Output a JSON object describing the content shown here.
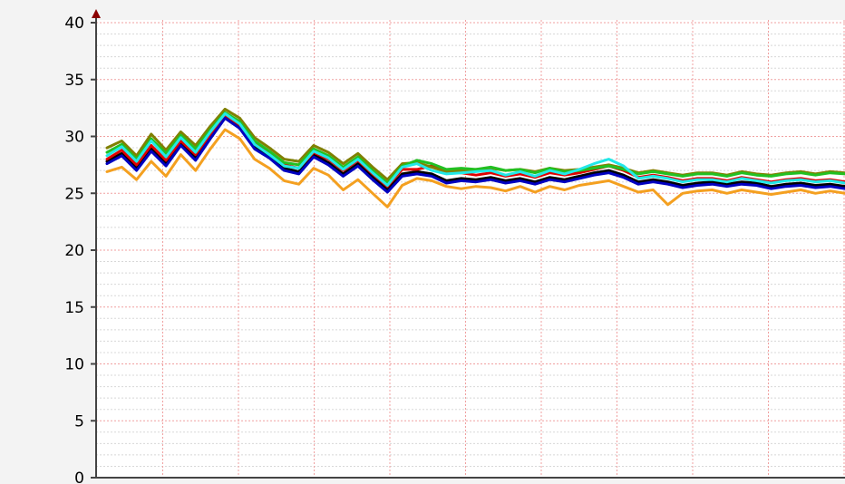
{
  "chart_data": {
    "type": "line",
    "title": "",
    "xlabel": "",
    "ylabel": "",
    "ylim": [
      0,
      40
    ],
    "yticks": [
      0,
      5,
      10,
      15,
      20,
      25,
      30,
      35,
      40
    ],
    "xlim": [
      0,
      100
    ],
    "grid": true,
    "x": [
      0,
      2,
      4,
      6,
      8,
      10,
      12,
      14,
      16,
      18,
      20,
      22,
      24,
      26,
      28,
      30,
      32,
      34,
      36,
      38,
      40,
      42,
      44,
      46,
      48,
      50,
      52,
      54,
      56,
      58,
      60,
      62,
      64,
      66,
      68,
      70,
      72,
      74,
      76,
      78,
      80,
      82,
      84,
      86,
      88,
      90,
      92,
      94,
      96,
      98,
      100
    ],
    "series": [
      {
        "color": "#000000",
        "values": [
          27.8,
          28.5,
          27.2,
          28.9,
          27.6,
          29.4,
          28.1,
          30.0,
          31.8,
          30.9,
          29.1,
          28.3,
          27.2,
          26.9,
          28.4,
          27.7,
          26.7,
          27.6,
          26.4,
          25.3,
          26.7,
          26.9,
          26.7,
          26.1,
          26.3,
          26.2,
          26.4,
          26.1,
          26.3,
          26.0,
          26.4,
          26.2,
          26.5,
          26.8,
          27.0,
          26.6,
          26.0,
          26.2,
          26.0,
          25.7,
          25.9,
          26.0,
          25.8,
          26.0,
          25.9,
          25.6,
          25.8,
          25.9,
          25.7,
          25.8,
          25.6
        ]
      },
      {
        "color": "#e00000",
        "values": [
          28.0,
          28.8,
          27.5,
          29.2,
          27.9,
          29.6,
          28.4,
          30.2,
          31.9,
          31.0,
          29.4,
          28.6,
          27.5,
          27.2,
          28.6,
          28.0,
          27.0,
          27.9,
          26.7,
          25.6,
          27.1,
          27.1,
          27.4,
          26.9,
          26.8,
          26.6,
          26.8,
          26.5,
          26.7,
          26.4,
          26.8,
          26.6,
          26.8,
          27.1,
          27.4,
          27.0,
          26.4,
          26.6,
          26.4,
          26.1,
          26.3,
          26.3,
          26.1,
          26.4,
          26.2,
          26.0,
          26.2,
          26.3,
          26.1,
          26.2,
          26.0
        ]
      },
      {
        "color": "#0000c0",
        "values": [
          27.6,
          28.3,
          27.0,
          28.7,
          27.4,
          29.2,
          27.9,
          29.8,
          31.6,
          30.7,
          28.9,
          28.1,
          27.0,
          26.7,
          28.2,
          27.5,
          26.5,
          27.4,
          26.2,
          25.1,
          26.5,
          26.7,
          26.5,
          25.9,
          26.1,
          26.0,
          26.2,
          25.9,
          26.1,
          25.8,
          26.2,
          26.0,
          26.3,
          26.6,
          26.8,
          26.4,
          25.8,
          26.0,
          25.8,
          25.5,
          25.7,
          25.8,
          25.6,
          25.8,
          25.7,
          25.4,
          25.6,
          25.7,
          25.5,
          25.6,
          25.4
        ]
      },
      {
        "color": "#808000",
        "values": [
          29.0,
          29.6,
          28.3,
          30.2,
          28.8,
          30.4,
          29.2,
          30.9,
          32.4,
          31.6,
          29.9,
          29.0,
          28.0,
          27.8,
          29.2,
          28.6,
          27.6,
          28.5,
          27.3,
          26.2,
          27.6,
          27.7,
          27.3,
          26.9,
          27.0,
          27.1,
          27.2,
          27.0,
          27.1,
          26.9,
          27.2,
          27.0,
          27.1,
          27.3,
          27.5,
          27.2,
          26.8,
          27.0,
          26.8,
          26.6,
          26.8,
          26.8,
          26.6,
          26.9,
          26.7,
          26.6,
          26.8,
          26.9,
          26.7,
          26.9,
          26.8
        ]
      },
      {
        "color": "#22c022",
        "values": [
          28.6,
          29.3,
          28.0,
          29.8,
          28.5,
          30.1,
          28.9,
          30.6,
          32.1,
          31.3,
          29.6,
          28.7,
          27.7,
          27.5,
          28.9,
          28.3,
          27.3,
          28.2,
          27.0,
          25.9,
          27.4,
          27.9,
          27.6,
          27.1,
          27.2,
          27.1,
          27.3,
          27.0,
          27.1,
          26.8,
          27.2,
          26.9,
          27.0,
          27.2,
          27.4,
          27.1,
          26.7,
          26.9,
          26.7,
          26.5,
          26.7,
          26.7,
          26.5,
          26.8,
          26.6,
          26.5,
          26.7,
          26.8,
          26.6,
          26.8,
          26.7
        ]
      },
      {
        "color": "#f4a020",
        "values": [
          26.9,
          27.3,
          26.2,
          27.8,
          26.5,
          28.4,
          27.0,
          28.9,
          30.6,
          29.8,
          28.0,
          27.2,
          26.1,
          25.8,
          27.2,
          26.6,
          25.3,
          26.2,
          25.0,
          23.8,
          25.7,
          26.3,
          26.1,
          25.6,
          25.4,
          25.6,
          25.5,
          25.2,
          25.6,
          25.1,
          25.6,
          25.3,
          25.7,
          25.9,
          26.1,
          25.6,
          25.1,
          25.3,
          24.0,
          25.0,
          25.2,
          25.3,
          25.0,
          25.3,
          25.1,
          24.9,
          25.1,
          25.3,
          25.0,
          25.2,
          25.0
        ]
      },
      {
        "color": "#22e8e8",
        "values": [
          28.3,
          29.1,
          27.8,
          29.6,
          28.2,
          29.9,
          28.6,
          30.4,
          32.0,
          31.1,
          29.3,
          28.4,
          27.4,
          27.2,
          28.7,
          28.1,
          27.1,
          28.0,
          26.8,
          25.7,
          27.3,
          27.6,
          27.0,
          26.7,
          26.8,
          26.9,
          27.0,
          26.6,
          26.9,
          26.5,
          27.0,
          26.7,
          27.1,
          27.6,
          28.0,
          27.4,
          26.3,
          26.5,
          26.3,
          26.0,
          26.2,
          26.2,
          26.0,
          26.3,
          26.1,
          25.9,
          26.1,
          26.2,
          26.0,
          26.1,
          25.9
        ]
      }
    ]
  }
}
